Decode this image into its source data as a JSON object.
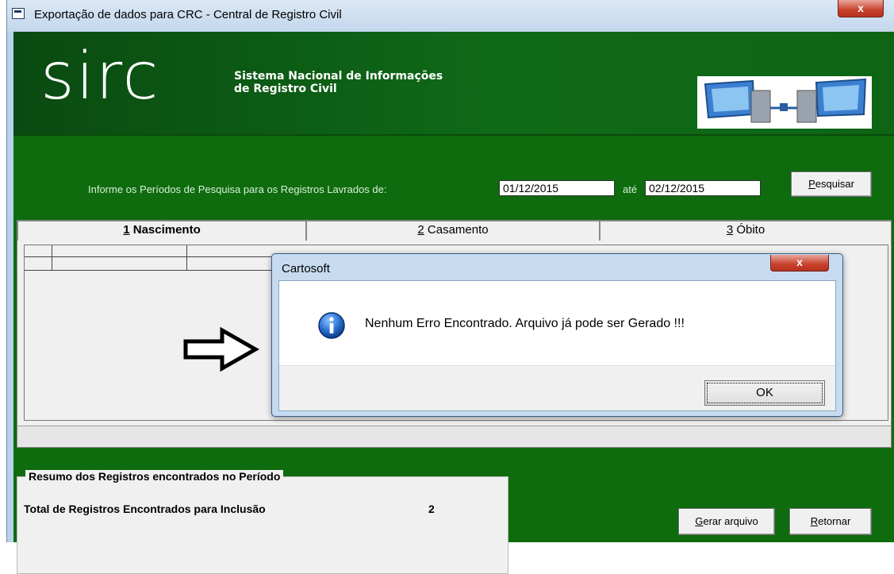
{
  "window": {
    "title": "Exportação de dados para CRC  - Central de Registro Civil",
    "close_glyph": "x"
  },
  "banner": {
    "logo": "sirc",
    "subtitle_line1": "Sistema Nacional de Informações",
    "subtitle_line2": "de Registro Civil",
    "image": "network-computers-icon"
  },
  "search": {
    "label": "Informe os Períodos de Pesquisa para os Registros Lavrados de:",
    "date_from": "01/12/2015",
    "ate_label": "até",
    "date_to": "02/12/2015",
    "button_key": "P",
    "button_rest": "esquisar"
  },
  "tabs": [
    {
      "key": "1",
      "label": " Nascimento",
      "active": true
    },
    {
      "key": "2",
      "label": " Casamento",
      "active": false
    },
    {
      "key": "3",
      "label": " Óbito",
      "active": false
    }
  ],
  "summary": {
    "legend": "Resumo dos Registros encontrados no Período",
    "total_label": "Total de Registros Encontrados para Inclusão",
    "total_value": "2"
  },
  "actions": {
    "generate_key": "G",
    "generate_rest": "erar arquivo",
    "back_key": "R",
    "back_rest": "etornar"
  },
  "dialog": {
    "title": "Cartosoft",
    "message": "Nenhum Erro Encontrado. Arquivo já pode ser Gerado !!!",
    "ok_label": "OK",
    "close_glyph": "x"
  }
}
